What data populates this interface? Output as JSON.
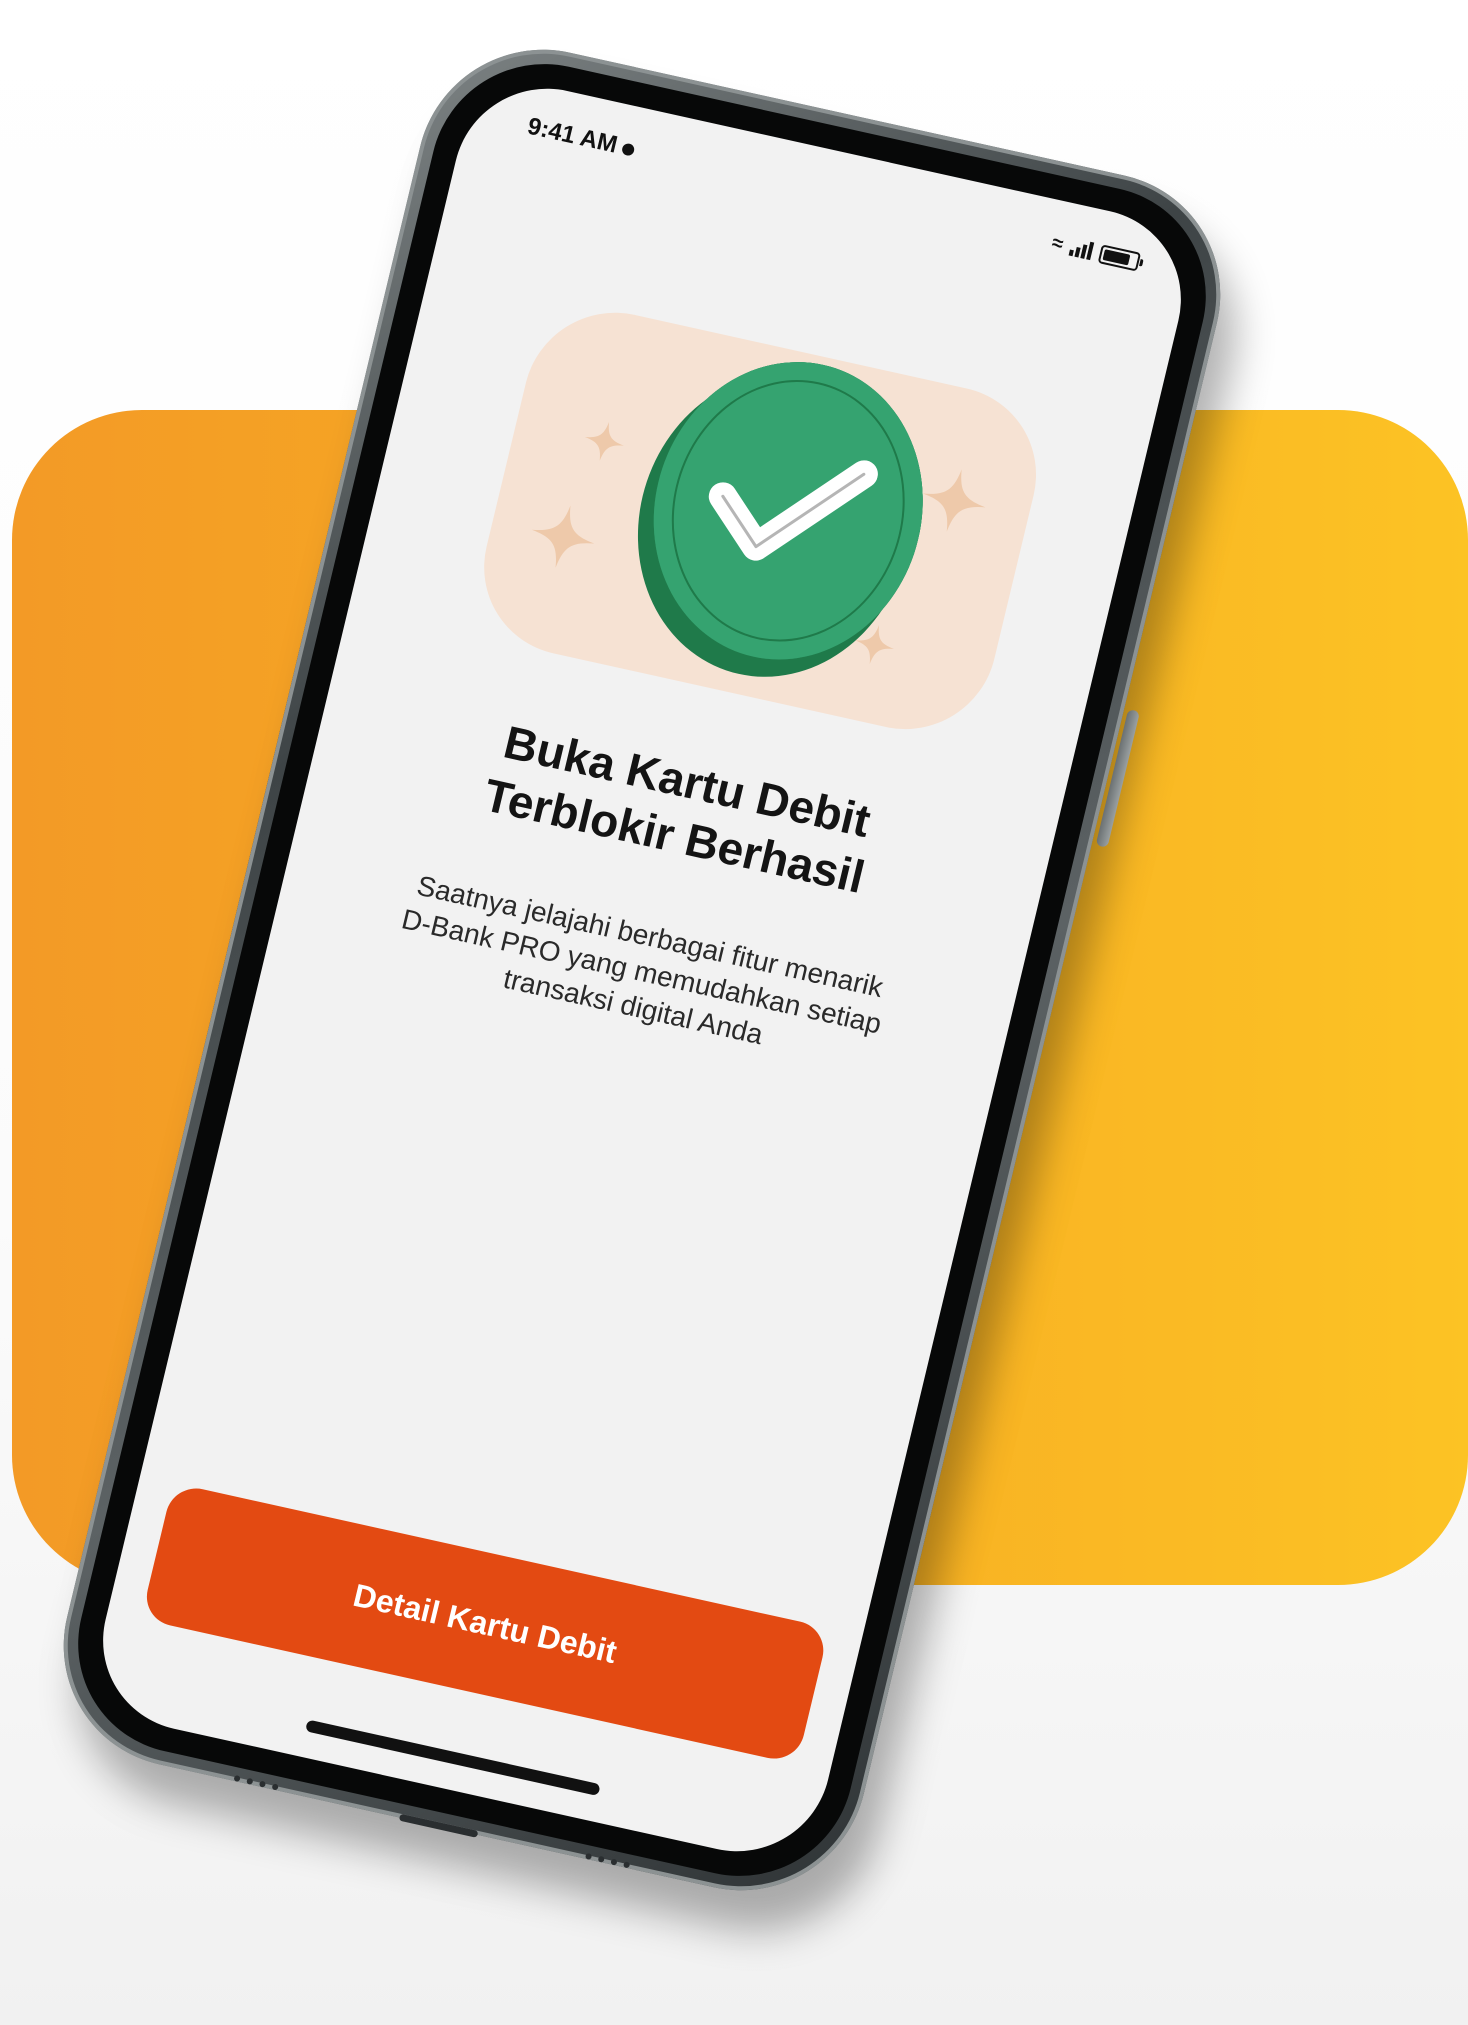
{
  "status_bar": {
    "time": "9:41 AM",
    "icons": [
      "alarm-icon",
      "wifi-icon",
      "signal-icon",
      "battery-icon"
    ]
  },
  "illustration": {
    "icon": "check-circle-icon",
    "colors": {
      "background": "#f6e2d3",
      "badge": "#35a370",
      "badge_shadow": "#1f7a4a",
      "sparkle": "#eec9aa"
    }
  },
  "content": {
    "title_line1": "Buka Kartu Debit",
    "title_line2": "Terblokir Berhasil",
    "desc_line1": "Saatnya jelajahi berbagai fitur menarik",
    "desc_line2": "D-Bank PRO yang memudahkan setiap",
    "desc_line3": "transaksi digital Anda"
  },
  "cta": {
    "label": "Detail Kartu Debit",
    "color": "#e34a12"
  },
  "theme": {
    "backdrop_start": "#f39a26",
    "backdrop_end": "#fcc324"
  }
}
